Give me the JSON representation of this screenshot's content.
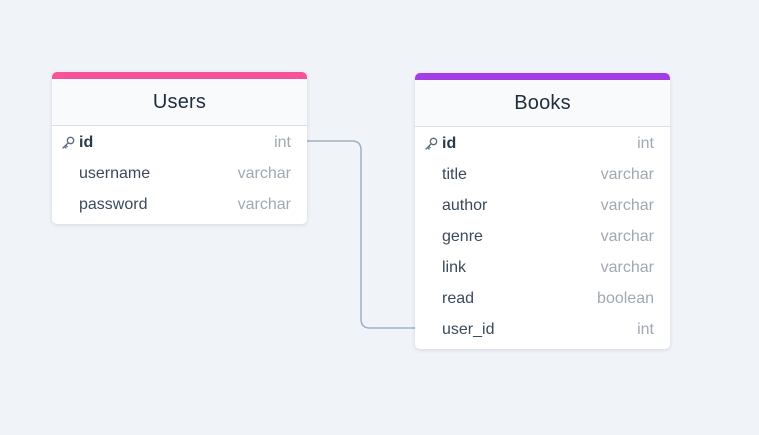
{
  "colors": {
    "background": "#f0f4f8",
    "users_accent": "#f7539b",
    "books_accent": "#a43de3",
    "connector": "#9fb0c3"
  },
  "tables": [
    {
      "name": "Users",
      "columns": [
        {
          "name": "id",
          "type": "int",
          "primary_key": true
        },
        {
          "name": "username",
          "type": "varchar"
        },
        {
          "name": "password",
          "type": "varchar"
        }
      ]
    },
    {
      "name": "Books",
      "columns": [
        {
          "name": "id",
          "type": "int",
          "primary_key": true
        },
        {
          "name": "title",
          "type": "varchar"
        },
        {
          "name": "author",
          "type": "varchar"
        },
        {
          "name": "genre",
          "type": "varchar"
        },
        {
          "name": "link",
          "type": "varchar"
        },
        {
          "name": "read",
          "type": "boolean"
        },
        {
          "name": "user_id",
          "type": "int"
        }
      ]
    }
  ],
  "relationships": [
    {
      "from": "Users.id",
      "to": "Books.user_id"
    }
  ]
}
